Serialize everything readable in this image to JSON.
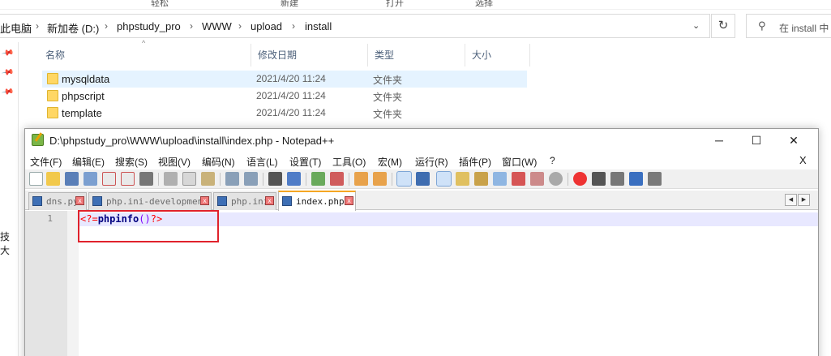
{
  "explorer": {
    "ribbon": [
      "轻松",
      "新建",
      "打开",
      "选择"
    ],
    "breadcrumb": [
      "此电脑",
      "新加卷 (D:)",
      "phpstudy_pro",
      "WWW",
      "upload",
      "install"
    ],
    "search_placeholder": "在 install 中",
    "nav_cut_label": "技大",
    "columns": {
      "name": "名称",
      "date": "修改日期",
      "type": "类型",
      "size": "大小"
    },
    "files": [
      {
        "name": "mysqldata",
        "date": "2021/4/20 11:24",
        "type": "文件夹"
      },
      {
        "name": "phpscript",
        "date": "2021/4/20 11:24",
        "type": "文件夹"
      },
      {
        "name": "template",
        "date": "2021/4/20 11:24",
        "type": "文件夹"
      }
    ]
  },
  "notepad": {
    "title": "D:\\phpstudy_pro\\WWW\\upload\\install\\index.php - Notepad++",
    "menu": [
      "文件(F)",
      "编辑(E)",
      "搜索(S)",
      "视图(V)",
      "编码(N)",
      "语言(L)",
      "设置(T)",
      "工具(O)",
      "宏(M)",
      "运行(R)",
      "插件(P)",
      "窗口(W)",
      "?"
    ],
    "menu_close": "X",
    "tabs": [
      "dns.py",
      "php.ini-development",
      "php.ini",
      "index.php"
    ],
    "active_tab": "index.php",
    "line_number": "1",
    "code": {
      "open_tag": "<?=",
      "func": "phpinfo",
      "parens": "()",
      "close_tag": "?>"
    },
    "colors": {
      "tag": "#ff0000",
      "func": "#000080",
      "highlight": "#e0222c",
      "caret_line": "#e8e8ff"
    }
  }
}
